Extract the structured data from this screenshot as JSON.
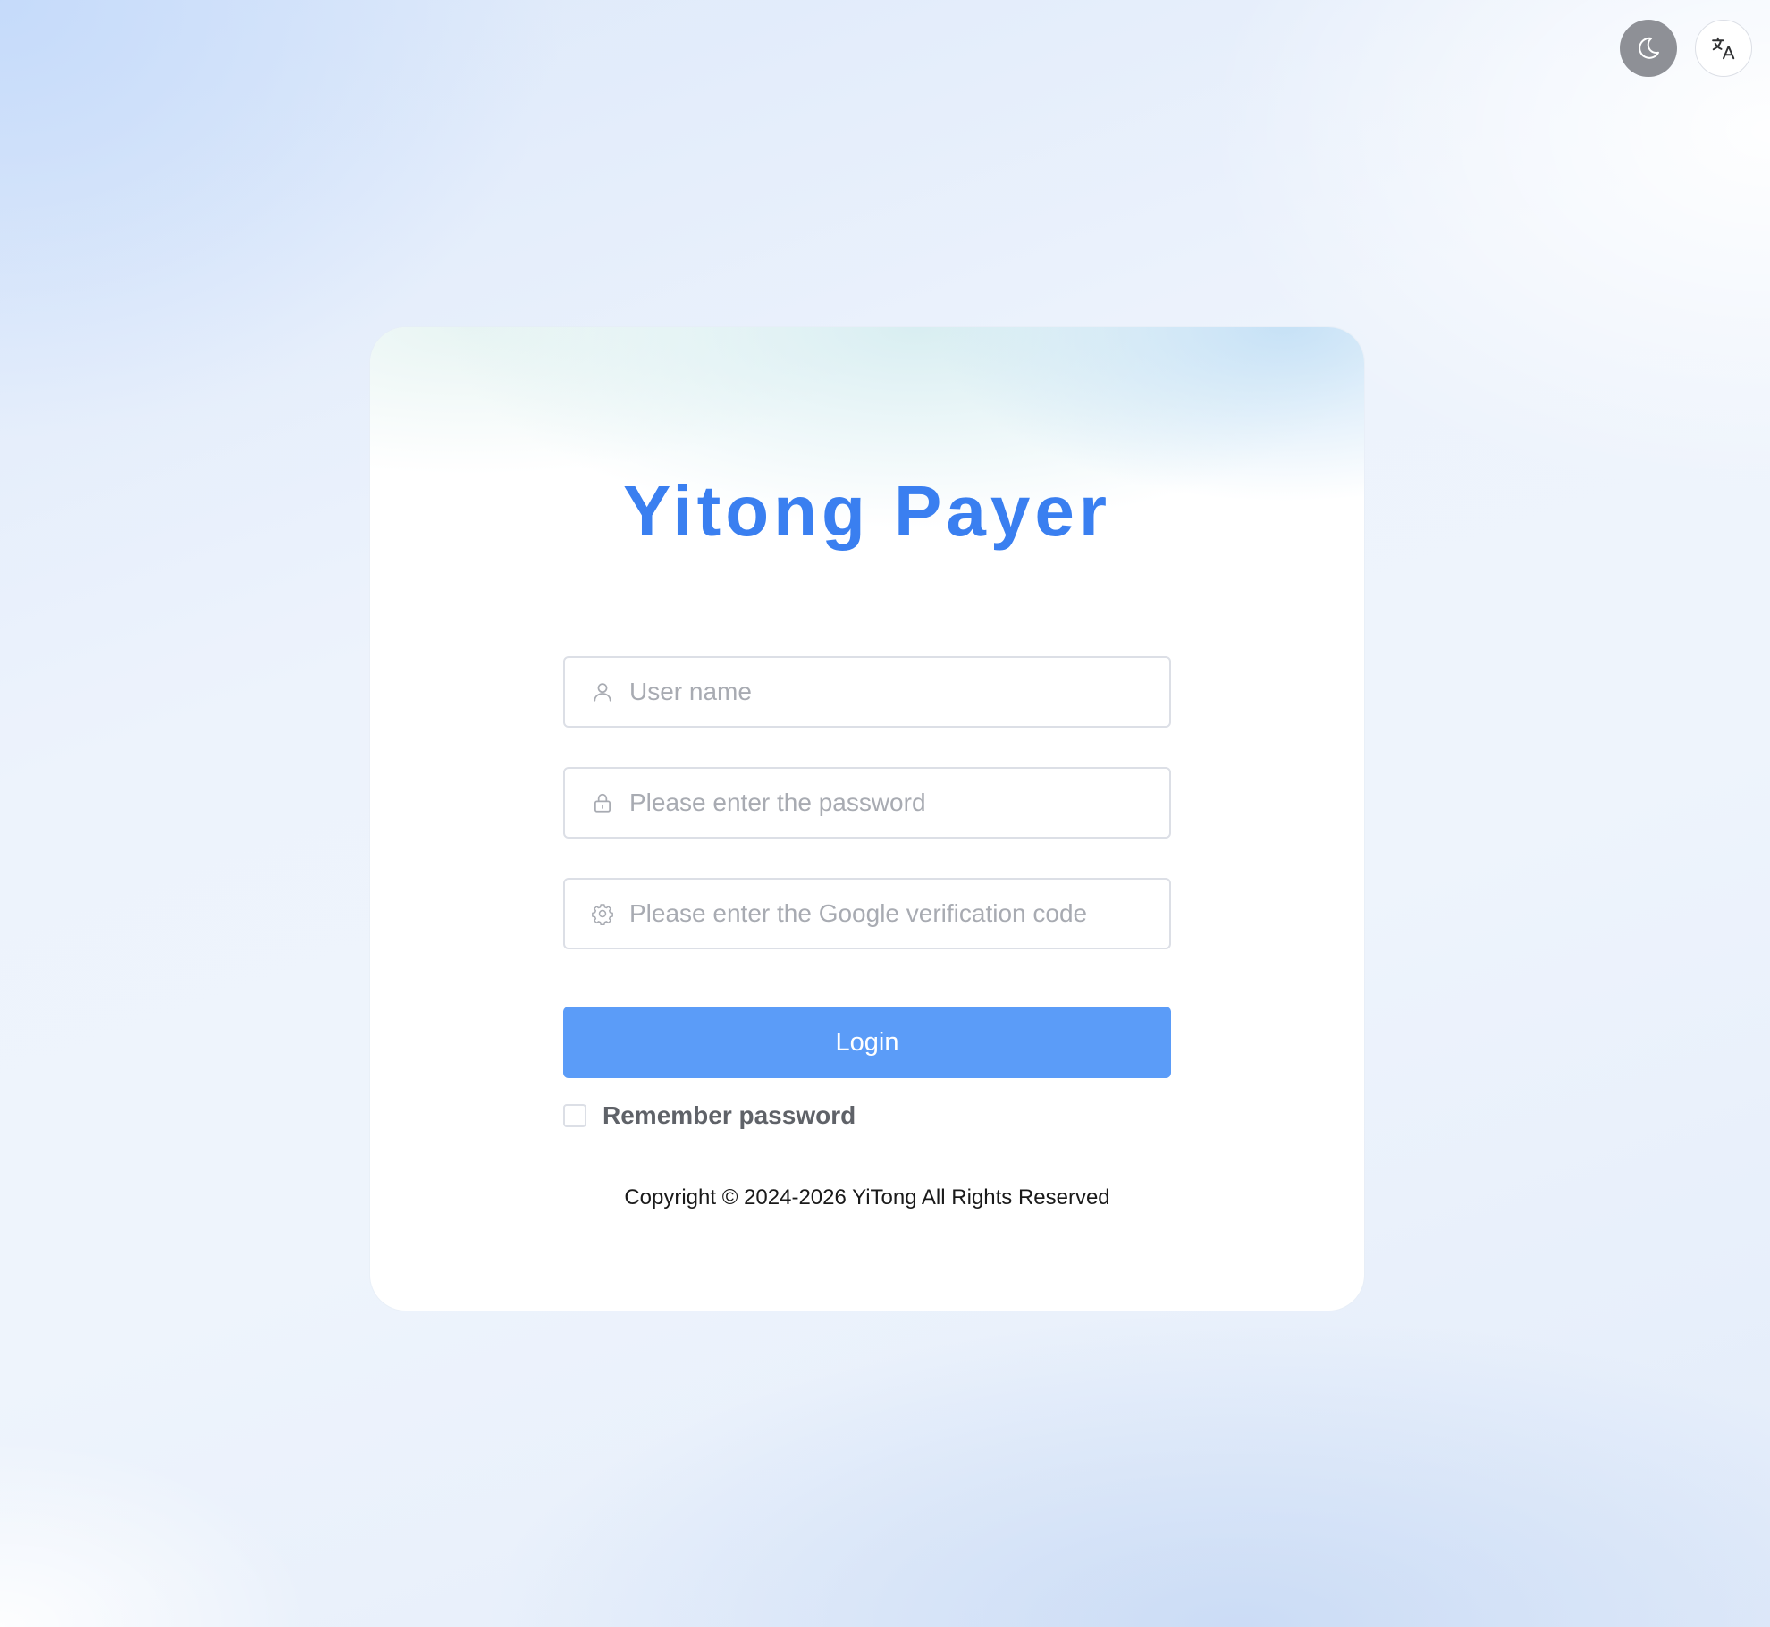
{
  "app": {
    "title": "Yitong Payer"
  },
  "top_controls": {
    "theme_icon": "moon-icon",
    "language_icon": "translate-icon"
  },
  "form": {
    "username": {
      "value": "",
      "placeholder": "User name",
      "icon": "user-icon"
    },
    "password": {
      "value": "",
      "placeholder": "Please enter the password",
      "icon": "lock-icon"
    },
    "google_code": {
      "value": "",
      "placeholder": "Please enter the Google verification code",
      "icon": "gear-icon"
    },
    "login_label": "Login",
    "remember_label": "Remember password",
    "remember_checked": false
  },
  "footer": {
    "copyright": "Copyright © 2024-2026 YiTong All Rights Reserved"
  },
  "colors": {
    "accent": "#3a7ff0",
    "button": "#5b9cf8",
    "placeholder": "#a8abb2",
    "border": "#dcdfe6"
  }
}
